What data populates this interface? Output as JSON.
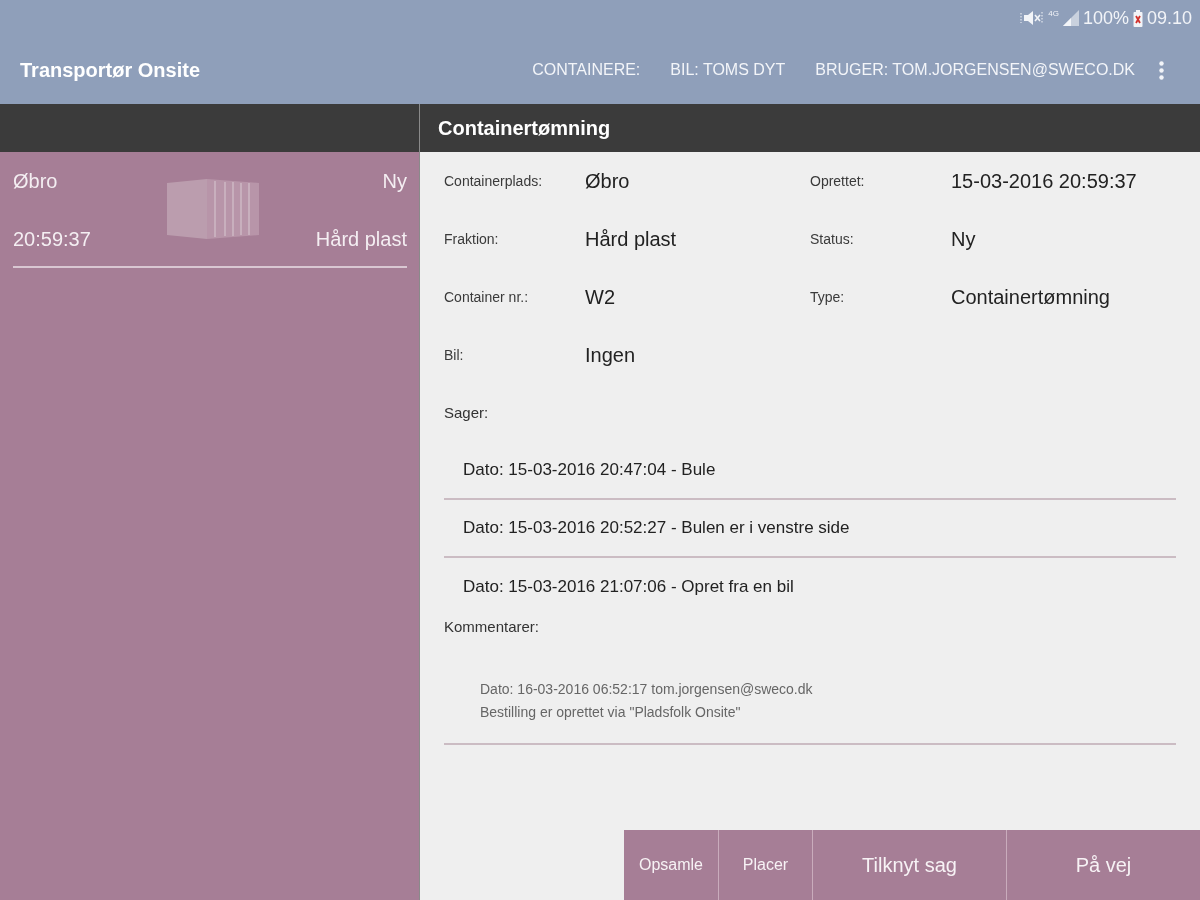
{
  "status_bar": {
    "network": "4G",
    "battery": "100%",
    "time": "09.10"
  },
  "app_bar": {
    "title": "Transportør Onsite",
    "actions": [
      "CONTAINERE:",
      "BIL: TOMS DYT",
      "BRUGER: TOM.JORGENSEN@SWECO.DK"
    ]
  },
  "container_list": {
    "items": [
      {
        "place": "Øbro",
        "status": "Ny",
        "time": "20:59:37",
        "fraction": "Hård plast"
      }
    ]
  },
  "detail": {
    "title": "Containertømning",
    "fields": [
      {
        "label": "Containerplads:",
        "value": "Øbro"
      },
      {
        "label": "Oprettet:",
        "value": "15-03-2016 20:59:37"
      },
      {
        "label": "Fraktion:",
        "value": "Hård plast"
      },
      {
        "label": "Status:",
        "value": "Ny"
      },
      {
        "label": "Container nr.:",
        "value": "W2"
      },
      {
        "label": "Type:",
        "value": "Containertømning"
      },
      {
        "label": "Bil:",
        "value": "Ingen"
      }
    ],
    "cases_label": "Sager:",
    "cases": [
      "Dato: 15-03-2016 20:47:04 - Bule",
      "Dato: 15-03-2016 20:52:27 - Bulen er i venstre side",
      "Dato: 15-03-2016 21:07:06 - Opret fra en bil"
    ],
    "comments_label": "Kommentarer:",
    "comments": [
      {
        "header": "Dato: 16-03-2016 06:52:17 tom.jorgensen@sweco.dk",
        "text": "Bestilling er oprettet via \"Pladsfolk Onsite\""
      }
    ]
  },
  "action_buttons": [
    "Opsamle",
    "Placer",
    "Tilknyt sag",
    "På vej"
  ]
}
